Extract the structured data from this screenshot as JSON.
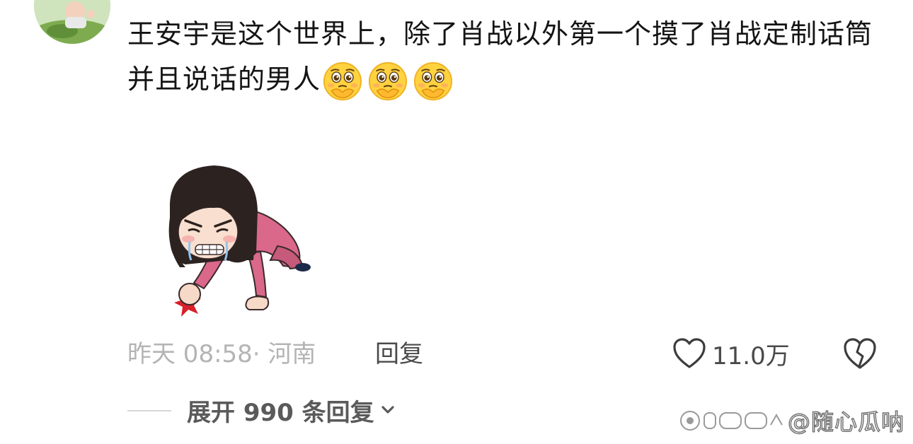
{
  "comment": {
    "text": "王安宇是这个世界上，除了肖战以外第一个摸了肖战定制话筒并且说话的男人",
    "emoji_icons": [
      "pleading-hug-emoji",
      "pleading-hug-emoji",
      "pleading-hug-emoji"
    ]
  },
  "sticker_icon": "girl-crawling-frustrated-sticker",
  "meta": {
    "time_location": "昨天 08:58· 河南",
    "reply_label": "回复"
  },
  "actions": {
    "like_icon": "heart-outline-icon",
    "like_count": "11.0万",
    "dislike_icon": "broken-heart-icon"
  },
  "expand": {
    "label": "展开 990 条回复",
    "icon": "chevron-down-icon"
  },
  "watermark": {
    "text": "@随心瓜呐"
  },
  "colors": {
    "background": "#ffffff",
    "primary_text": "#141414",
    "secondary_text": "#b4b4b4",
    "action_text": "#4a4a4a"
  }
}
